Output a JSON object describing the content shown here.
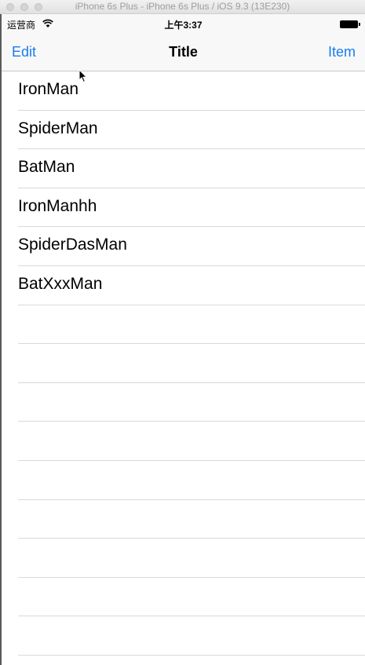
{
  "window": {
    "title": "iPhone 6s Plus - iPhone 6s Plus / iOS 9.3 (13E230)"
  },
  "status_bar": {
    "carrier": "运营商",
    "time": "上午3:37",
    "wifi_icon": "wifi-icon",
    "battery_icon": "battery-icon"
  },
  "nav": {
    "left_label": "Edit",
    "title": "Title",
    "right_label": "Item"
  },
  "rows": [
    {
      "label": "IronMan"
    },
    {
      "label": "SpiderMan"
    },
    {
      "label": "BatMan"
    },
    {
      "label": "IronManhh"
    },
    {
      "label": "SpiderDasMan"
    },
    {
      "label": "BatXxxMan"
    },
    {
      "label": ""
    },
    {
      "label": ""
    },
    {
      "label": ""
    },
    {
      "label": ""
    },
    {
      "label": ""
    },
    {
      "label": ""
    },
    {
      "label": ""
    },
    {
      "label": ""
    },
    {
      "label": ""
    }
  ],
  "colors": {
    "tint": "#1a7cf0",
    "separator": "#d9d9dd",
    "bar_background": "#f8f8f8"
  }
}
